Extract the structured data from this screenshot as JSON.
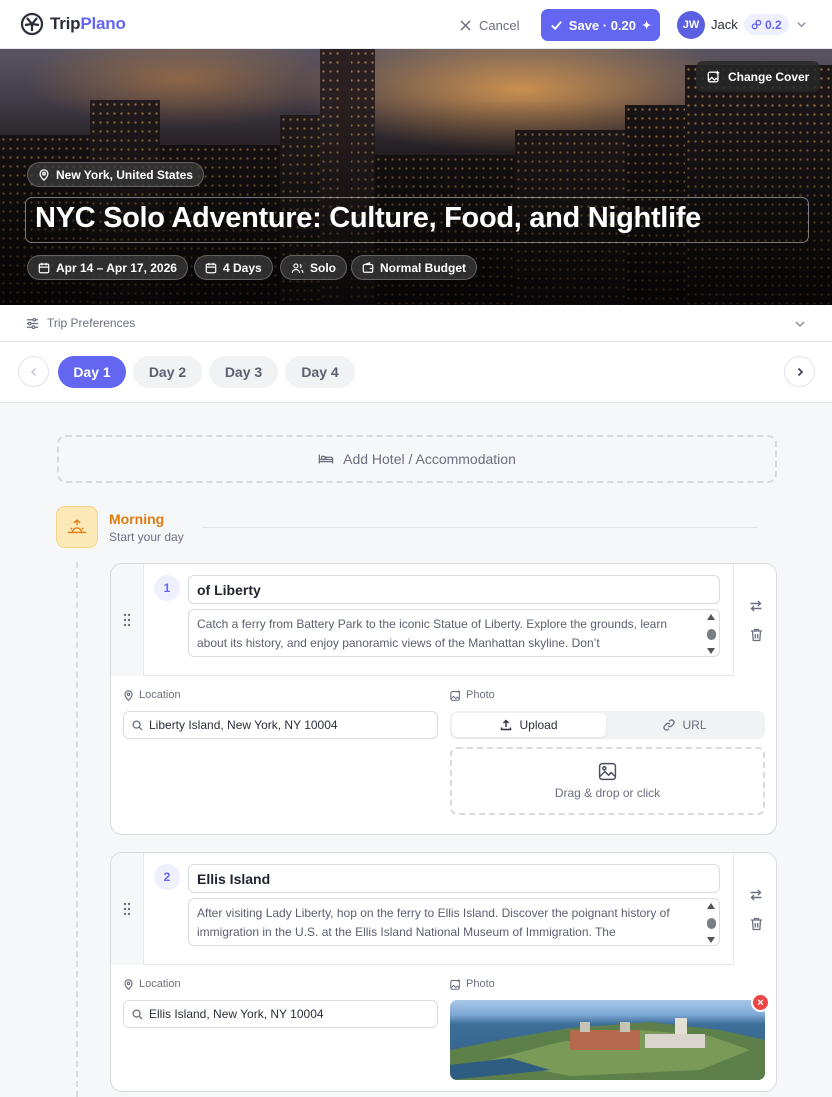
{
  "app": {
    "name_a": "Trip",
    "name_b": "Plano"
  },
  "header": {
    "cancel_label": "Cancel",
    "save_label": "Save · 0.20",
    "user_initials": "JW",
    "user_name": "Jack",
    "credits": "0.2"
  },
  "hero": {
    "change_cover_label": "Change Cover",
    "location": "New York, United States",
    "title": "NYC Solo Adventure: Culture, Food, and Nightlife",
    "chips": {
      "dates": "Apr 14 – Apr 17, 2026",
      "days": "4 Days",
      "travelers": "Solo",
      "budget": "Normal Budget"
    }
  },
  "preferences": {
    "label": "Trip Preferences"
  },
  "days": {
    "tabs": [
      "Day 1",
      "Day 2",
      "Day 3",
      "Day 4"
    ],
    "active": "Day 1"
  },
  "hotel": {
    "label": "Add Hotel / Accommodation"
  },
  "morning": {
    "title": "Morning",
    "subtitle": "Start your day"
  },
  "activities": [
    {
      "number": "1",
      "name": "of Liberty",
      "description": "Catch a ferry from Battery Park to the iconic Statue of Liberty. Explore the grounds, learn about its history, and enjoy panoramic views of the Manhattan skyline. Don’t",
      "location_label": "Location",
      "location": "Liberty Island, New York, NY 10004",
      "photo_label": "Photo",
      "upload_label": "Upload",
      "url_label": "URL",
      "drop_label": "Drag & drop or click"
    },
    {
      "number": "2",
      "name": "Ellis Island",
      "description": "After visiting Lady Liberty, hop on the ferry to Ellis Island. Discover the poignant history of immigration in the U.S. at the Ellis Island National Museum of Immigration. The",
      "location_label": "Location",
      "location": "Ellis Island, New York, NY 10004",
      "photo_label": "Photo",
      "remove_icon": "×"
    }
  ],
  "colors": {
    "accent": "#6366f1",
    "morning": "#e07b10",
    "danger": "#ef4444"
  }
}
